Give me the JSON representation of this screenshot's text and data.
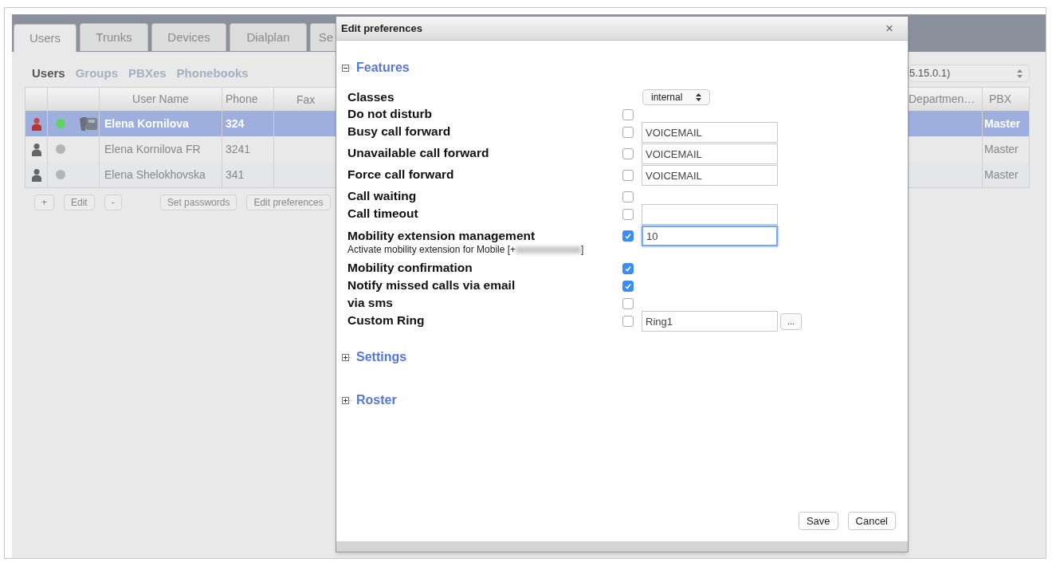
{
  "tabs": [
    {
      "label": "Users",
      "selected": true
    },
    {
      "label": "Trunks",
      "selected": false
    },
    {
      "label": "Devices",
      "selected": false
    },
    {
      "label": "Dialplan",
      "selected": false
    },
    {
      "label": "Se",
      "selected": false
    }
  ],
  "subnav": [
    {
      "label": "Users",
      "selected": true
    },
    {
      "label": "Groups",
      "selected": false
    },
    {
      "label": "PBXes",
      "selected": false
    },
    {
      "label": "Phonebooks",
      "selected": false
    }
  ],
  "pbx_select": {
    "value": "5.15.0.1)"
  },
  "table": {
    "columns": [
      "User Name",
      "Phone",
      "Fax",
      "Departmen…",
      "PBX"
    ],
    "rows": [
      {
        "selected": true,
        "color": "#5fd35f",
        "has_phone": true,
        "user_name": "Elena Kornilova",
        "phone": "324",
        "pbx": "Master"
      },
      {
        "selected": false,
        "color": "#b4b4b4",
        "has_phone": false,
        "user_name": "Elena Kornilova FR",
        "phone": "3241",
        "pbx": "Master"
      },
      {
        "selected": false,
        "color": "#b4b4b4",
        "has_phone": false,
        "user_name": "Elena Shelokhovska",
        "phone": "341",
        "pbx": "Master"
      }
    ]
  },
  "table_buttons": [
    "+",
    "Edit",
    "-",
    "Set passwords",
    "Edit preferences"
  ],
  "dialog": {
    "title": "Edit preferences",
    "close": "×",
    "sections": [
      {
        "title": "Features",
        "expanded": true,
        "rows": [
          {
            "kind": "select",
            "label": "Classes",
            "value": "internal"
          },
          {
            "kind": "checkbox",
            "label": "Do not disturb",
            "checked": false
          },
          {
            "kind": "field",
            "label": "Busy call forward",
            "checked": false,
            "value": "VOICEMAIL"
          },
          {
            "kind": "field",
            "label": "Unavailable call forward",
            "checked": false,
            "value": "VOICEMAIL"
          },
          {
            "kind": "field",
            "label": "Force call forward",
            "checked": false,
            "value": "VOICEMAIL"
          },
          {
            "kind": "checkbox",
            "label": "Call waiting",
            "checked": false
          },
          {
            "kind": "field",
            "label": "Call timeout",
            "checked": false
          },
          {
            "kind": "field",
            "label": "Mobility extension management",
            "checked": true,
            "value": "10",
            "focused": true,
            "note_prefix": "Activate mobility extension for Mobile [+",
            "note_suffix": "]"
          },
          {
            "kind": "checkbox",
            "label": "Mobility confirmation",
            "checked": true
          },
          {
            "kind": "checkbox",
            "label": "Notify missed calls via email",
            "checked": true
          },
          {
            "kind": "checkbox",
            "label": "via sms",
            "checked": false
          },
          {
            "kind": "browse",
            "label": "Custom Ring",
            "checked": false,
            "value": "Ring1",
            "button": "..."
          }
        ]
      },
      {
        "title": "Settings",
        "expanded": false
      },
      {
        "title": "Roster",
        "expanded": false
      }
    ],
    "buttons": [
      "Save",
      "Cancel"
    ]
  }
}
